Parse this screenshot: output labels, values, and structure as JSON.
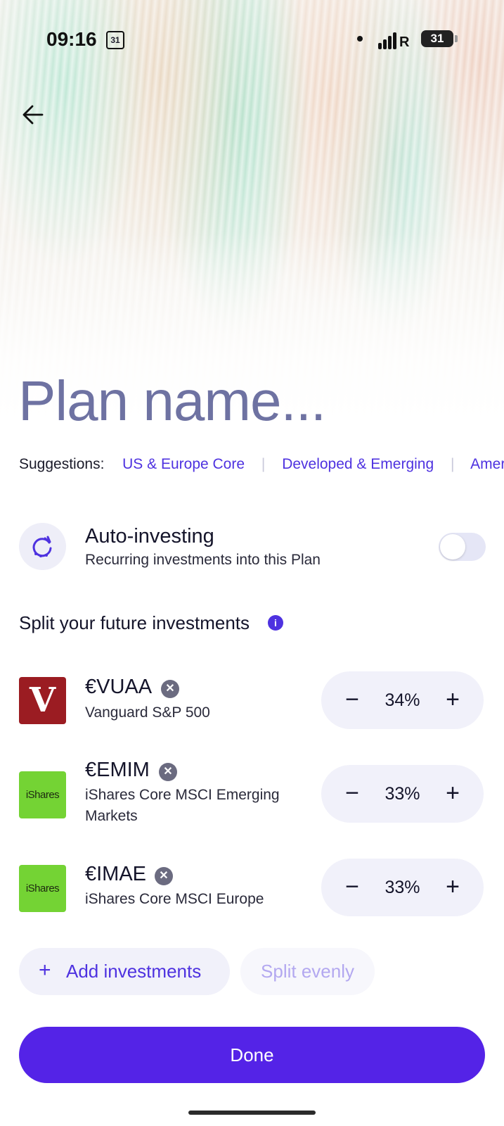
{
  "status_bar": {
    "time": "09:16",
    "calendar_day": "31",
    "network": "R",
    "battery": "31"
  },
  "header": {
    "plan_name_placeholder": "Plan name..."
  },
  "suggestions": {
    "label": "Suggestions:",
    "items": [
      "US & Europe Core",
      "Developed & Emerging",
      "Amer"
    ]
  },
  "auto_investing": {
    "title": "Auto-investing",
    "subtitle": "Recurring investments into this Plan",
    "enabled": false
  },
  "split": {
    "title": "Split your future investments",
    "info_icon": "i"
  },
  "investments": [
    {
      "ticker": "€VUAA",
      "name": "Vanguard S&P 500",
      "percent": "34%",
      "logo_text": "V",
      "logo_color": "#9b1c22"
    },
    {
      "ticker": "€EMIM",
      "name": "iShares Core MSCI Emerging Markets",
      "percent": "33%",
      "logo_text": "iShares",
      "logo_color": "#74d334"
    },
    {
      "ticker": "€IMAE",
      "name": "iShares Core MSCI Europe",
      "percent": "33%",
      "logo_text": "iShares",
      "logo_color": "#74d334"
    }
  ],
  "stepper": {
    "minus": "−",
    "plus": "+"
  },
  "actions": {
    "add_label": "Add investments",
    "add_icon": "+",
    "split_evenly_label": "Split evenly",
    "done_label": "Done"
  },
  "colors": {
    "accent": "#5423e7",
    "link": "#4e32e0",
    "placeholder": "#6e72a2"
  }
}
